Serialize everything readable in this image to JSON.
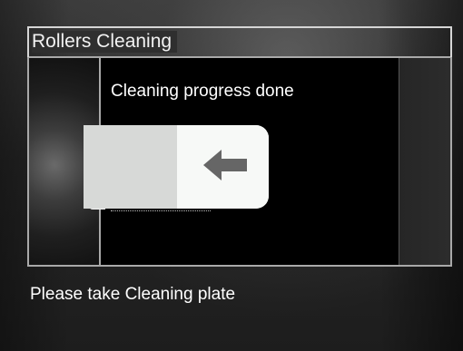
{
  "header": {
    "title": "Rollers Cleaning"
  },
  "main": {
    "status_text": "Cleaning progress done"
  },
  "illustration": {
    "plate_icon": "cleaning-plate-icon",
    "arrow_icon": "arrow-left-icon"
  },
  "footer": {
    "instruction_text": "Please take Cleaning plate"
  },
  "colors": {
    "background": "#262626",
    "panel": "#000000",
    "frame": "#d6d6d6",
    "plate_left": "#d7d9d7",
    "plate_right": "#f7f9f7",
    "arrow": "#666666"
  }
}
